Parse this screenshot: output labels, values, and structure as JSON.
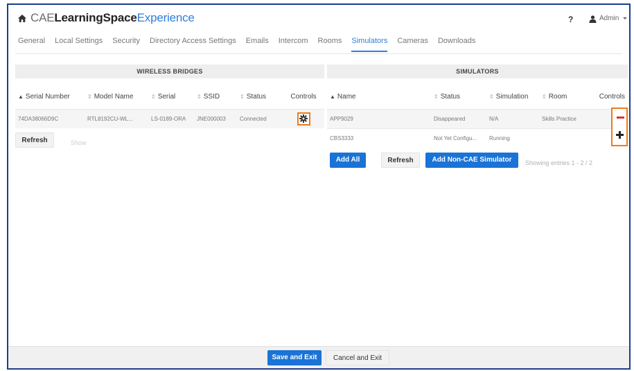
{
  "header": {
    "brand_part1": "CAE",
    "brand_part2": "LearningSpace",
    "brand_part3": "Experience",
    "help": "?",
    "user": "Admin"
  },
  "nav": {
    "tabs": [
      "General",
      "Local Settings",
      "Security",
      "Directory Access Settings",
      "Emails",
      "Intercom",
      "Rooms",
      "Simulators",
      "Cameras",
      "Downloads"
    ],
    "active": "Simulators"
  },
  "wireless": {
    "title": "WIRELESS BRIDGES",
    "columns": [
      "Serial Number",
      "Model Name",
      "Serial",
      "SSID",
      "Status",
      "Controls"
    ],
    "rows": [
      [
        "74DA38066D9C",
        "RTL8192CU-WL...",
        "LS-0189-ORA",
        "JNE000003",
        "Connected"
      ]
    ],
    "refresh_label": "Refresh",
    "show_label": "Show"
  },
  "simulators": {
    "title": "SIMULATORS",
    "columns": [
      "Name",
      "Status",
      "Simulation",
      "Room",
      "Controls"
    ],
    "rows": [
      [
        "APP9029",
        "Disappeared",
        "N/A",
        "Skills Practice"
      ],
      [
        "CBS3333",
        "Not Yet Configu...",
        "Running",
        ""
      ]
    ],
    "add_all_label": "Add All",
    "refresh_label": "Refresh",
    "add_noncae_label": "Add Non-CAE Simulator",
    "entries_text": "Showing entries 1 - 2 / 2"
  },
  "footer": {
    "save_label": "Save and Exit",
    "cancel_label": "Cancel and Exit"
  },
  "colors": {
    "accent": "#2f7ed8",
    "button_blue": "#1a73d6",
    "highlight_orange": "#f07a1a",
    "remove_red": "#e0302f",
    "frame_border": "#1a3e8c"
  },
  "icons": {
    "home": "home-icon",
    "user": "user-icon",
    "settings": "gear-icon",
    "remove": "minus-icon",
    "add": "plus-icon"
  }
}
